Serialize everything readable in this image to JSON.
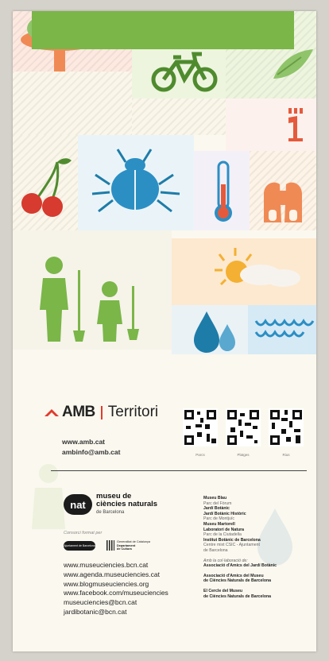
{
  "amb": {
    "name": "AMB",
    "territori": "Territori",
    "web": "www.amb.cat",
    "email": "ambinfo@amb.cat",
    "qr_labels": [
      "Parcs",
      "Platges",
      "Rius"
    ]
  },
  "museu": {
    "logo_word": "nat",
    "name_line1": "museu de",
    "name_line2": "ciències naturals",
    "name_line3": "de Barcelona",
    "consorci": "Consorci format per",
    "ajuntament": "Ajuntament de Barcelona",
    "generalitat_line1": "Generalitat de Catalunya",
    "generalitat_line2": "Departament",
    "generalitat_line3": "de Cultura",
    "links": [
      "www.museuciencies.bcn.cat",
      "www.agenda.museuciencies.cat",
      "www.blogmuseuciencies.org",
      "www.facebook.com/museuciencies",
      "museuciencies@bcn.cat",
      "jardibotanic@bcn.cat"
    ]
  },
  "venues": {
    "museu_blau": "Museu Blau",
    "museu_blau_place": "Parc del Fòrum",
    "jardi": "Jardí Botànic",
    "jardi_historic": "Jardí Botànic Històric",
    "jardi_place": "Parc de Montjuïc",
    "martorell": "Museu Martorell",
    "laboratori": "Laboratori de Natura",
    "laboratori_place": "Parc de la Ciutadella",
    "institut": "Institut Botànic de Barcelona",
    "institut_note1": "Centre mixt CSIC - Ajuntament",
    "institut_note2": "de Barcelona",
    "collab": "Amb la col·laboració de:",
    "amics_jardi": "Associació d'Amics del Jardí Botànic",
    "amics_museu_1": "Associació d'Amics del Museu",
    "amics_museu_2": "de Ciències Naturals de Barcelona",
    "cercle_1": "El Cercle del Museu",
    "cercle_2": "de Ciències Naturals de Barcelona"
  }
}
